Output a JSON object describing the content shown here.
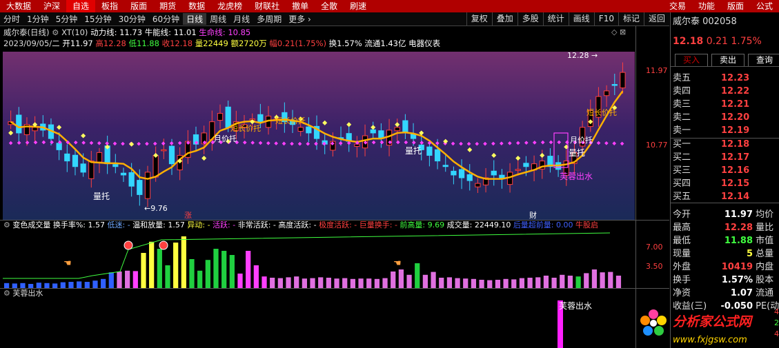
{
  "menubar": {
    "items": [
      "大数据",
      "沪深",
      "自选",
      "板指",
      "版面",
      "期货",
      "数据",
      "龙虎榜",
      "财联社",
      "撤单",
      "全散",
      "刷速"
    ],
    "right": [
      "交易",
      "功能",
      "版面",
      "公式"
    ],
    "active": 2
  },
  "toolbar": {
    "periods": [
      "分时",
      "1分钟",
      "5分钟",
      "15分钟",
      "30分钟",
      "60分钟",
      "日线",
      "周线",
      "月线",
      "多周期",
      "更多 ›"
    ],
    "active": 6,
    "right": [
      "复权",
      "叠加",
      "多股",
      "统计",
      "画线",
      "F10",
      "标记",
      "返回"
    ]
  },
  "header": {
    "name": "威尔泰(日线)",
    "xt": "XT(10)",
    "dongli": "动力线: 11.73",
    "niuneng": "牛能线: 11.01",
    "shengming": "生命线: 10.85",
    "date": "2023/09/05/二",
    "open": "开11.97",
    "high": "高12.28",
    "low": "低11.88",
    "close": "收12.18",
    "vol": "量22449",
    "amount": "额2720万",
    "fu": "幅0.21(1.75%)",
    "huanshou": "换1.57%",
    "liutong": "流通1.43亿",
    "industry": "电器仪表"
  },
  "axis": {
    "p1": [
      "11.97",
      "10.77"
    ],
    "p2": [
      "7.00",
      "3.50"
    ]
  },
  "annotations": {
    "peak": "12.28",
    "low": "9.76",
    "zhang": "涨",
    "cai": "财",
    "liangtuo1": "量托",
    "liangtuo2": "量托",
    "liangtuo3": "量托",
    "duanchang1": "短长价托",
    "duanchang2": "短长价托",
    "duanchang3": "短长价托",
    "yuejia1": "月价托",
    "yuejia2": "月价托",
    "furong": "芙蓉出水",
    "furong2": "芙蓉出水"
  },
  "panel2": {
    "title": "变色成交量",
    "items": [
      {
        "t": "换手率%: 1.57",
        "c": "#ffffff"
      },
      {
        "t": "低迷: -",
        "c": "#6fa8ff"
      },
      {
        "t": "温和放量: 1.57",
        "c": "#ffffff"
      },
      {
        "t": "异动: -",
        "c": "#ffff40"
      },
      {
        "t": "活跃: -",
        "c": "#ff40ff"
      },
      {
        "t": "非常活跃: -",
        "c": "#ffffff"
      },
      {
        "t": "高度活跃: -",
        "c": "#ffffff"
      },
      {
        "t": "极度活跃: -",
        "c": "#ff4040"
      },
      {
        "t": "巨量换手: -",
        "c": "#ff4040"
      },
      {
        "t": "前高量: 9.69",
        "c": "#40ff40"
      },
      {
        "t": "成交量: 22449.10",
        "c": "#ffffff"
      },
      {
        "t": "后量超前量: 0.00",
        "c": "#4060ff"
      },
      {
        "t": "牛股启",
        "c": "#ff4040"
      }
    ]
  },
  "panel3": {
    "title": "芙蓉出水"
  },
  "quote": {
    "name": "威尔泰",
    "code": "002058",
    "price": "12.18",
    "chg": "0.21",
    "pct": "1.75%",
    "buy": "买入",
    "sell": "卖出",
    "query": "查询",
    "asks": [
      [
        "卖五",
        "12.23"
      ],
      [
        "卖四",
        "12.22"
      ],
      [
        "卖三",
        "12.21"
      ],
      [
        "卖二",
        "12.20"
      ],
      [
        "卖一",
        "12.19"
      ]
    ],
    "bids": [
      [
        "买一",
        "12.18"
      ],
      [
        "买二",
        "12.17"
      ],
      [
        "买三",
        "12.16"
      ],
      [
        "买四",
        "12.15"
      ],
      [
        "买五",
        "12.14"
      ]
    ],
    "stats": [
      [
        "今开",
        "11.97",
        "均价",
        ""
      ],
      [
        "最高",
        "12.28",
        "量比",
        ""
      ],
      [
        "最低",
        "11.88",
        "市值",
        ""
      ],
      [
        "现量",
        "5",
        "总量",
        ""
      ],
      [
        "外盘",
        "10419",
        "内盘",
        ""
      ],
      [
        "换手",
        "1.57%",
        "股本",
        ""
      ],
      [
        "净资",
        "1.07",
        "流通",
        ""
      ],
      [
        "收益(三)",
        "-0.050",
        "PE(动)",
        ""
      ]
    ],
    "side_nums": [
      "4",
      "2",
      "4"
    ]
  },
  "logo": {
    "text": "分析家公式网",
    "url": "www.fxjgsw.com"
  }
}
